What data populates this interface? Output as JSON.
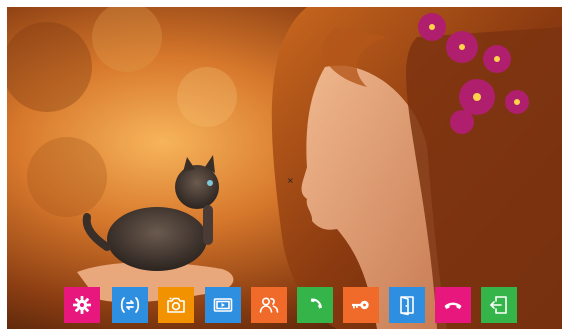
{
  "toolbar": {
    "buttons": [
      {
        "id": "settings",
        "icon": "gear-icon",
        "color": "#e8177d"
      },
      {
        "id": "switch-source",
        "icon": "switch-arrows-icon",
        "color": "#2e8fe0"
      },
      {
        "id": "snapshot",
        "icon": "camera-icon",
        "color": "#f39200"
      },
      {
        "id": "video-playback",
        "icon": "video-playback-icon",
        "color": "#2e8fe0"
      },
      {
        "id": "intercom",
        "icon": "users-icon",
        "color": "#f06a2a"
      },
      {
        "id": "answer-call",
        "icon": "phone-answer-icon",
        "color": "#35b44a"
      },
      {
        "id": "unlock",
        "icon": "key-icon",
        "color": "#f06a2a"
      },
      {
        "id": "door",
        "icon": "door-icon",
        "color": "#2e8fe0"
      },
      {
        "id": "hang-up",
        "icon": "phone-hangup-icon",
        "color": "#e8177d"
      },
      {
        "id": "exit",
        "icon": "exit-icon",
        "color": "#35b44a"
      }
    ]
  }
}
